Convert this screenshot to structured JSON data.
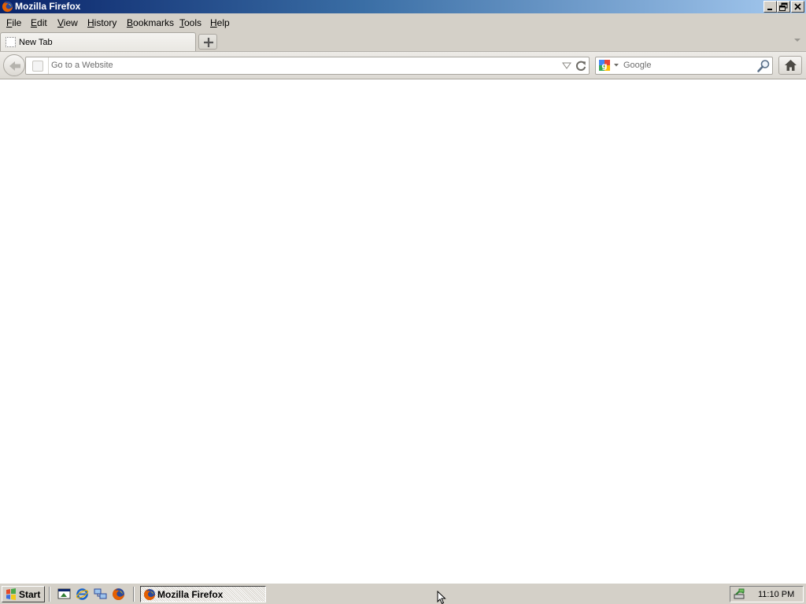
{
  "window": {
    "title": "Mozilla Firefox"
  },
  "menubar": {
    "items": [
      {
        "label": "File",
        "accel": "F",
        "rest": "ile"
      },
      {
        "label": "Edit",
        "accel": "E",
        "rest": "dit"
      },
      {
        "label": "View",
        "accel": "V",
        "rest": "iew"
      },
      {
        "label": "History",
        "accel": "H",
        "rest": "istory"
      },
      {
        "label": "Bookmarks",
        "accel": "B",
        "rest": "ookmarks"
      },
      {
        "label": "Tools",
        "accel": "T",
        "rest": "ools"
      },
      {
        "label": "Help",
        "accel": "H",
        "rest": "elp"
      }
    ]
  },
  "tabs": [
    {
      "label": "New Tab",
      "active": true
    }
  ],
  "navbar": {
    "url_placeholder": "Go to a Website",
    "url_value": "",
    "search_placeholder": "Google",
    "search_engine_icon": "google-icon"
  },
  "taskbar": {
    "start_label": "Start",
    "quicklaunch": [
      "show-desktop-icon",
      "internet-explorer-icon",
      "network-icon",
      "firefox-icon"
    ],
    "task_label": "Mozilla Firefox",
    "clock": "11:10 PM"
  },
  "colors": {
    "titlebar_start": "#0a246a",
    "titlebar_end": "#a6caf0",
    "chrome_gray": "#d4d0c8"
  }
}
